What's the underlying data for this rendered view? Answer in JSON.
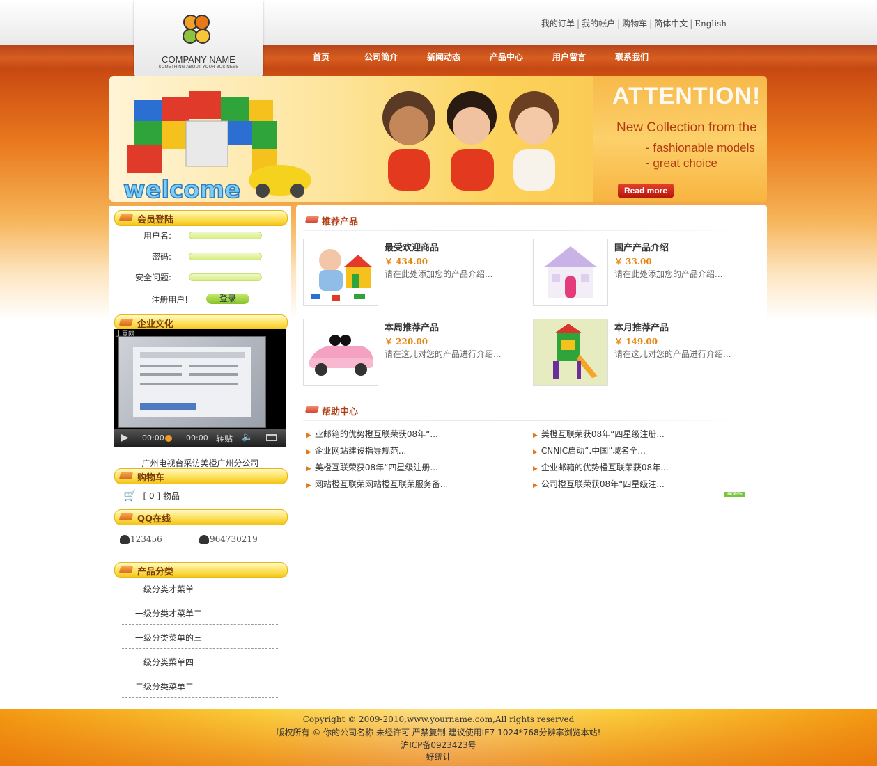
{
  "header": {
    "company_name": "COMPANY NAME",
    "company_sub": "SOMETHING ABOUT YOUR BUSINESS",
    "top_links": [
      "我的订单",
      "我的帐户",
      "购物车",
      "简体中文",
      "English"
    ],
    "nav": [
      "首页",
      "公司简介",
      "新闻动态",
      "产品中心",
      "用户留言",
      "联系我们"
    ]
  },
  "banner": {
    "headline": "ATTENTION!",
    "line1": "New Collection from the",
    "bullet1": "- fashionable models",
    "bullet2": "- great choice",
    "button": "Read more",
    "welcome": "welcome"
  },
  "sidebar": {
    "login": {
      "title": "会员登陆",
      "username_label": "用户名:",
      "password_label": "密码:",
      "security_label": "安全问题:",
      "register_label": "注册用户!",
      "login_button": "登录"
    },
    "culture": {
      "title": "企业文化",
      "video_tag": "土豆网",
      "time_current": "00:00",
      "time_total": "00:00",
      "share_label": "转贴",
      "caption": "广州电视台采访美橙广州分公司"
    },
    "cart": {
      "title": "购物车",
      "text": "[ 0 ] 物品"
    },
    "qq": {
      "title": "QQ在线",
      "items": [
        "123456",
        "964730219"
      ]
    },
    "categories": {
      "title": "产品分类",
      "items": [
        "一级分类才菜单一",
        "一级分类才菜单二",
        "一级分类菜单的三",
        "一级分类菜单四",
        "二级分类菜单二"
      ]
    }
  },
  "main": {
    "recommend_title": "推荐产品",
    "products": [
      {
        "name": "最受欢迎商品",
        "price": "￥ 434.00",
        "desc": "请在此处添加您的产品介绍..."
      },
      {
        "name": "国产产品介绍",
        "price": "￥ 33.00",
        "desc": "请在此处添加您的产品介绍..."
      },
      {
        "name": "本周推荐产品",
        "price": "￥ 220.00",
        "desc": "请在这儿对您的产品进行介绍..."
      },
      {
        "name": "本月推荐产品",
        "price": "￥ 149.00",
        "desc": "请在这儿对您的产品进行介绍..."
      }
    ],
    "help_title": "帮助中心",
    "help_left": [
      "业邮箱的优势橙互联荣获08年“...",
      "企业网站建设指导规范...",
      "美橙互联荣获08年“四星级注册...",
      "网站橙互联荣网站橙互联荣服务备..."
    ],
    "help_right": [
      "美橙互联荣获08年“四星级注册...",
      "CNNIC启动“.中国”域名全...",
      "企业邮箱的优势橙互联荣获08年...",
      "公司橙互联荣获08年“四星级注..."
    ],
    "more_label": "MORE+"
  },
  "footer": {
    "copyright": "Copyright © 2009-2010,www.yourname.com,All rights reserved",
    "line2": "版权所有 © 你的公司名称 未经许可 严禁复制 建议使用IE7 1024*768分辨率浏览本站!",
    "icp": "沪ICP备0923423号",
    "stats": "好统计"
  },
  "colors": {
    "nav_bar": "#c94a12",
    "accent_orange": "#e68612",
    "title_brown": "#7a3a08",
    "title_red": "#b23c12"
  }
}
